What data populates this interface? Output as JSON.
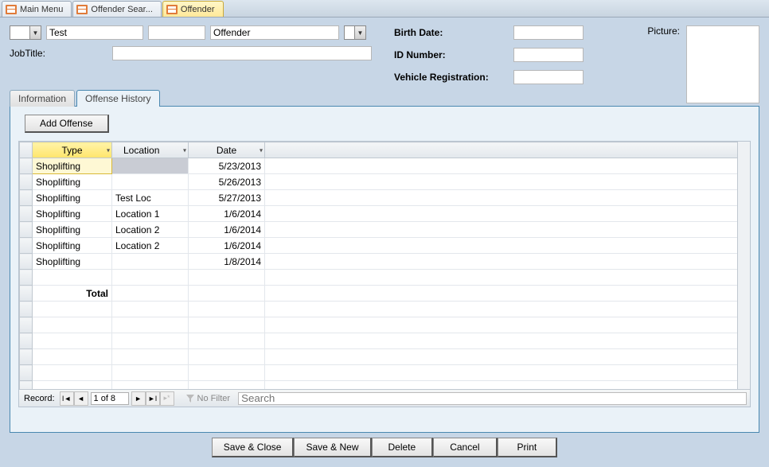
{
  "tabs": {
    "t0": "Main Menu",
    "t1": "Offender Sear...",
    "t2": "Offender"
  },
  "form": {
    "first": "Test",
    "mid": "",
    "last": "Offender",
    "jobtitle_lbl": "JobTitle:",
    "jobtitle_val": "",
    "birthdate_lbl": "Birth Date:",
    "idnum_lbl": "ID Number:",
    "vreg_lbl": "Vehicle Registration:",
    "picture_lbl": "Picture:"
  },
  "inner_tabs": {
    "info": "Information",
    "hist": "Offense History"
  },
  "add_btn": "Add Offense",
  "cols": {
    "type": "Type",
    "loc": "Location",
    "date": "Date"
  },
  "rows": [
    {
      "type": "Shoplifting",
      "loc": "",
      "date": "5/23/2013"
    },
    {
      "type": "Shoplifting",
      "loc": "",
      "date": "5/26/2013"
    },
    {
      "type": "Shoplifting",
      "loc": "Test Loc",
      "date": "5/27/2013"
    },
    {
      "type": "Shoplifting",
      "loc": "Location 1",
      "date": "1/6/2014"
    },
    {
      "type": "Shoplifting",
      "loc": "Location 2",
      "date": "1/6/2014"
    },
    {
      "type": "Shoplifting",
      "loc": "Location 2",
      "date": "1/6/2014"
    },
    {
      "type": "Shoplifting",
      "loc": "",
      "date": "1/8/2014"
    }
  ],
  "total_lbl": "Total",
  "recnav": {
    "label": "Record:",
    "pos": "1 of 8",
    "nofilter": "No Filter",
    "search_ph": "Search"
  },
  "buttons": {
    "saveclose": "Save & Close",
    "savenew": "Save & New",
    "delete": "Delete",
    "cancel": "Cancel",
    "print": "Print"
  }
}
